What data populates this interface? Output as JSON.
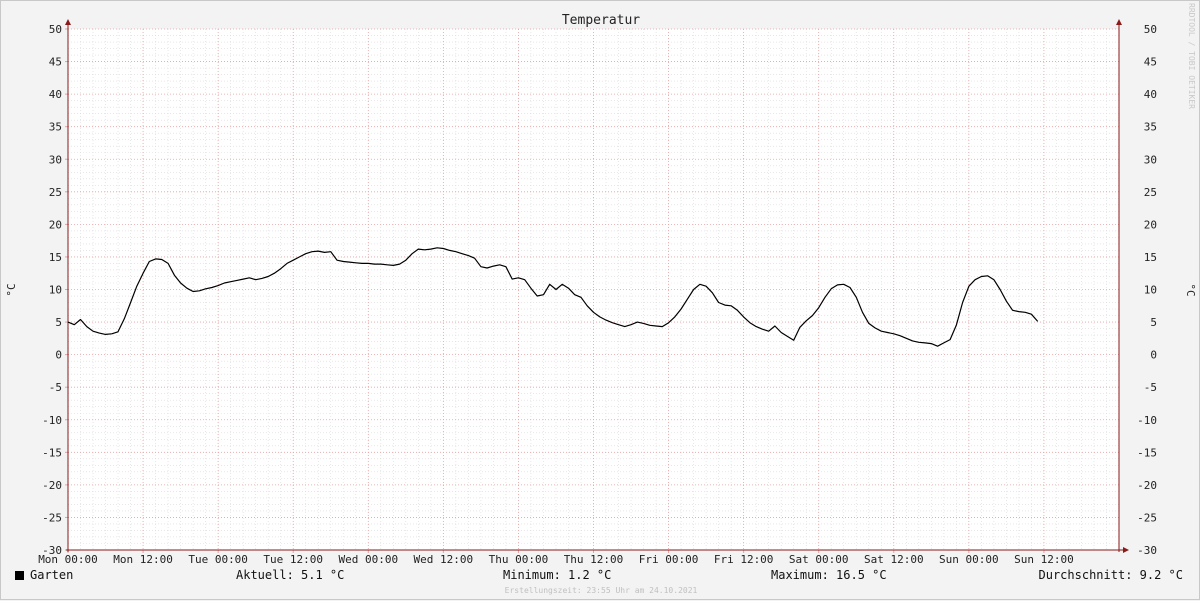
{
  "chart_data": {
    "type": "line",
    "title": "Temperatur",
    "ylabel": "°C",
    "ylim": [
      -30,
      50
    ],
    "yticks": [
      50,
      45,
      40,
      35,
      30,
      25,
      20,
      15,
      10,
      5,
      0,
      -5,
      -10,
      -15,
      -20,
      -25,
      -30
    ],
    "x_unit": "hours since Mon 00:00",
    "xlim": [
      0,
      168
    ],
    "xticks": [
      {
        "x": 0,
        "label": "Mon 00:00"
      },
      {
        "x": 12,
        "label": "Mon 12:00"
      },
      {
        "x": 24,
        "label": "Tue 00:00"
      },
      {
        "x": 36,
        "label": "Tue 12:00"
      },
      {
        "x": 48,
        "label": "Wed 00:00"
      },
      {
        "x": 60,
        "label": "Wed 12:00"
      },
      {
        "x": 72,
        "label": "Thu 00:00"
      },
      {
        "x": 84,
        "label": "Thu 12:00"
      },
      {
        "x": 96,
        "label": "Fri 00:00"
      },
      {
        "x": 108,
        "label": "Fri 12:00"
      },
      {
        "x": 120,
        "label": "Sat 00:00"
      },
      {
        "x": 132,
        "label": "Sat 12:00"
      },
      {
        "x": 144,
        "label": "Sun 00:00"
      },
      {
        "x": 156,
        "label": "Sun 12:00"
      }
    ],
    "grid": true,
    "series": [
      {
        "name": "Garten",
        "color": "#000000",
        "points": [
          [
            0,
            5.0
          ],
          [
            1,
            4.6
          ],
          [
            2,
            5.4
          ],
          [
            3,
            4.3
          ],
          [
            4,
            3.6
          ],
          [
            5,
            3.3
          ],
          [
            6,
            3.1
          ],
          [
            7,
            3.2
          ],
          [
            8,
            3.5
          ],
          [
            9,
            5.5
          ],
          [
            10,
            8.0
          ],
          [
            11,
            10.5
          ],
          [
            12,
            12.5
          ],
          [
            13,
            14.3
          ],
          [
            14,
            14.7
          ],
          [
            15,
            14.6
          ],
          [
            16,
            14.0
          ],
          [
            17,
            12.2
          ],
          [
            18,
            11.0
          ],
          [
            19,
            10.2
          ],
          [
            20,
            9.7
          ],
          [
            21,
            9.8
          ],
          [
            22,
            10.1
          ],
          [
            23,
            10.3
          ],
          [
            24,
            10.6
          ],
          [
            25,
            11.0
          ],
          [
            26,
            11.2
          ],
          [
            27,
            11.4
          ],
          [
            28,
            11.6
          ],
          [
            29,
            11.8
          ],
          [
            30,
            11.5
          ],
          [
            31,
            11.7
          ],
          [
            32,
            12.0
          ],
          [
            33,
            12.5
          ],
          [
            34,
            13.2
          ],
          [
            35,
            14.0
          ],
          [
            36,
            14.5
          ],
          [
            37,
            15.0
          ],
          [
            38,
            15.5
          ],
          [
            39,
            15.8
          ],
          [
            40,
            15.9
          ],
          [
            41,
            15.7
          ],
          [
            42,
            15.8
          ],
          [
            43,
            14.5
          ],
          [
            44,
            14.3
          ],
          [
            45,
            14.2
          ],
          [
            46,
            14.1
          ],
          [
            47,
            14.0
          ],
          [
            48,
            14.0
          ],
          [
            49,
            13.9
          ],
          [
            50,
            13.9
          ],
          [
            51,
            13.8
          ],
          [
            52,
            13.7
          ],
          [
            53,
            13.9
          ],
          [
            54,
            14.5
          ],
          [
            55,
            15.5
          ],
          [
            56,
            16.2
          ],
          [
            57,
            16.1
          ],
          [
            58,
            16.2
          ],
          [
            59,
            16.4
          ],
          [
            60,
            16.3
          ],
          [
            61,
            16.0
          ],
          [
            62,
            15.8
          ],
          [
            63,
            15.5
          ],
          [
            64,
            15.2
          ],
          [
            65,
            14.8
          ],
          [
            66,
            13.5
          ],
          [
            67,
            13.3
          ],
          [
            68,
            13.6
          ],
          [
            69,
            13.8
          ],
          [
            70,
            13.5
          ],
          [
            71,
            11.6
          ],
          [
            72,
            11.8
          ],
          [
            73,
            11.5
          ],
          [
            74,
            10.2
          ],
          [
            75,
            9.0
          ],
          [
            76,
            9.2
          ],
          [
            77,
            10.8
          ],
          [
            78,
            10.0
          ],
          [
            79,
            10.8
          ],
          [
            80,
            10.2
          ],
          [
            81,
            9.2
          ],
          [
            82,
            8.8
          ],
          [
            83,
            7.5
          ],
          [
            84,
            6.5
          ],
          [
            85,
            5.8
          ],
          [
            86,
            5.3
          ],
          [
            87,
            4.9
          ],
          [
            88,
            4.6
          ],
          [
            89,
            4.3
          ],
          [
            90,
            4.6
          ],
          [
            91,
            5.0
          ],
          [
            92,
            4.8
          ],
          [
            93,
            4.5
          ],
          [
            94,
            4.4
          ],
          [
            95,
            4.3
          ],
          [
            96,
            4.9
          ],
          [
            97,
            5.8
          ],
          [
            98,
            7.0
          ],
          [
            99,
            8.5
          ],
          [
            100,
            10.0
          ],
          [
            101,
            10.8
          ],
          [
            102,
            10.5
          ],
          [
            103,
            9.5
          ],
          [
            104,
            8.0
          ],
          [
            105,
            7.6
          ],
          [
            106,
            7.5
          ],
          [
            107,
            6.8
          ],
          [
            108,
            5.8
          ],
          [
            109,
            4.9
          ],
          [
            110,
            4.3
          ],
          [
            111,
            3.9
          ],
          [
            112,
            3.6
          ],
          [
            113,
            4.4
          ],
          [
            114,
            3.4
          ],
          [
            115,
            2.8
          ],
          [
            116,
            2.2
          ],
          [
            117,
            4.2
          ],
          [
            118,
            5.2
          ],
          [
            119,
            6.0
          ],
          [
            120,
            7.2
          ],
          [
            121,
            8.8
          ],
          [
            122,
            10.1
          ],
          [
            123,
            10.7
          ],
          [
            124,
            10.8
          ],
          [
            125,
            10.3
          ],
          [
            126,
            8.8
          ],
          [
            127,
            6.5
          ],
          [
            128,
            4.8
          ],
          [
            129,
            4.1
          ],
          [
            130,
            3.6
          ],
          [
            131,
            3.4
          ],
          [
            132,
            3.2
          ],
          [
            133,
            2.9
          ],
          [
            134,
            2.5
          ],
          [
            135,
            2.1
          ],
          [
            136,
            1.9
          ],
          [
            137,
            1.8
          ],
          [
            138,
            1.7
          ],
          [
            139,
            1.3
          ],
          [
            140,
            1.8
          ],
          [
            141,
            2.3
          ],
          [
            142,
            4.5
          ],
          [
            143,
            8.0
          ],
          [
            144,
            10.5
          ],
          [
            145,
            11.5
          ],
          [
            146,
            12.0
          ],
          [
            147,
            12.1
          ],
          [
            148,
            11.5
          ],
          [
            149,
            10.0
          ],
          [
            150,
            8.2
          ],
          [
            151,
            6.8
          ],
          [
            152,
            6.6
          ],
          [
            153,
            6.5
          ],
          [
            154,
            6.2
          ],
          [
            155,
            5.1
          ]
        ]
      }
    ]
  },
  "legend": {
    "series_name": "Garten",
    "current": "Aktuell: 5.1 °C",
    "minimum": "Minimum: 1.2 °C",
    "maximum": "Maximum: 16.5 °C",
    "average": "Durchschnitt: 9.2 °C"
  },
  "footer": {
    "created": "Erstellungszeit: 23:55 Uhr am 24.10.2021"
  },
  "watermark": "RRDTOOL / TOBI OETIKER"
}
